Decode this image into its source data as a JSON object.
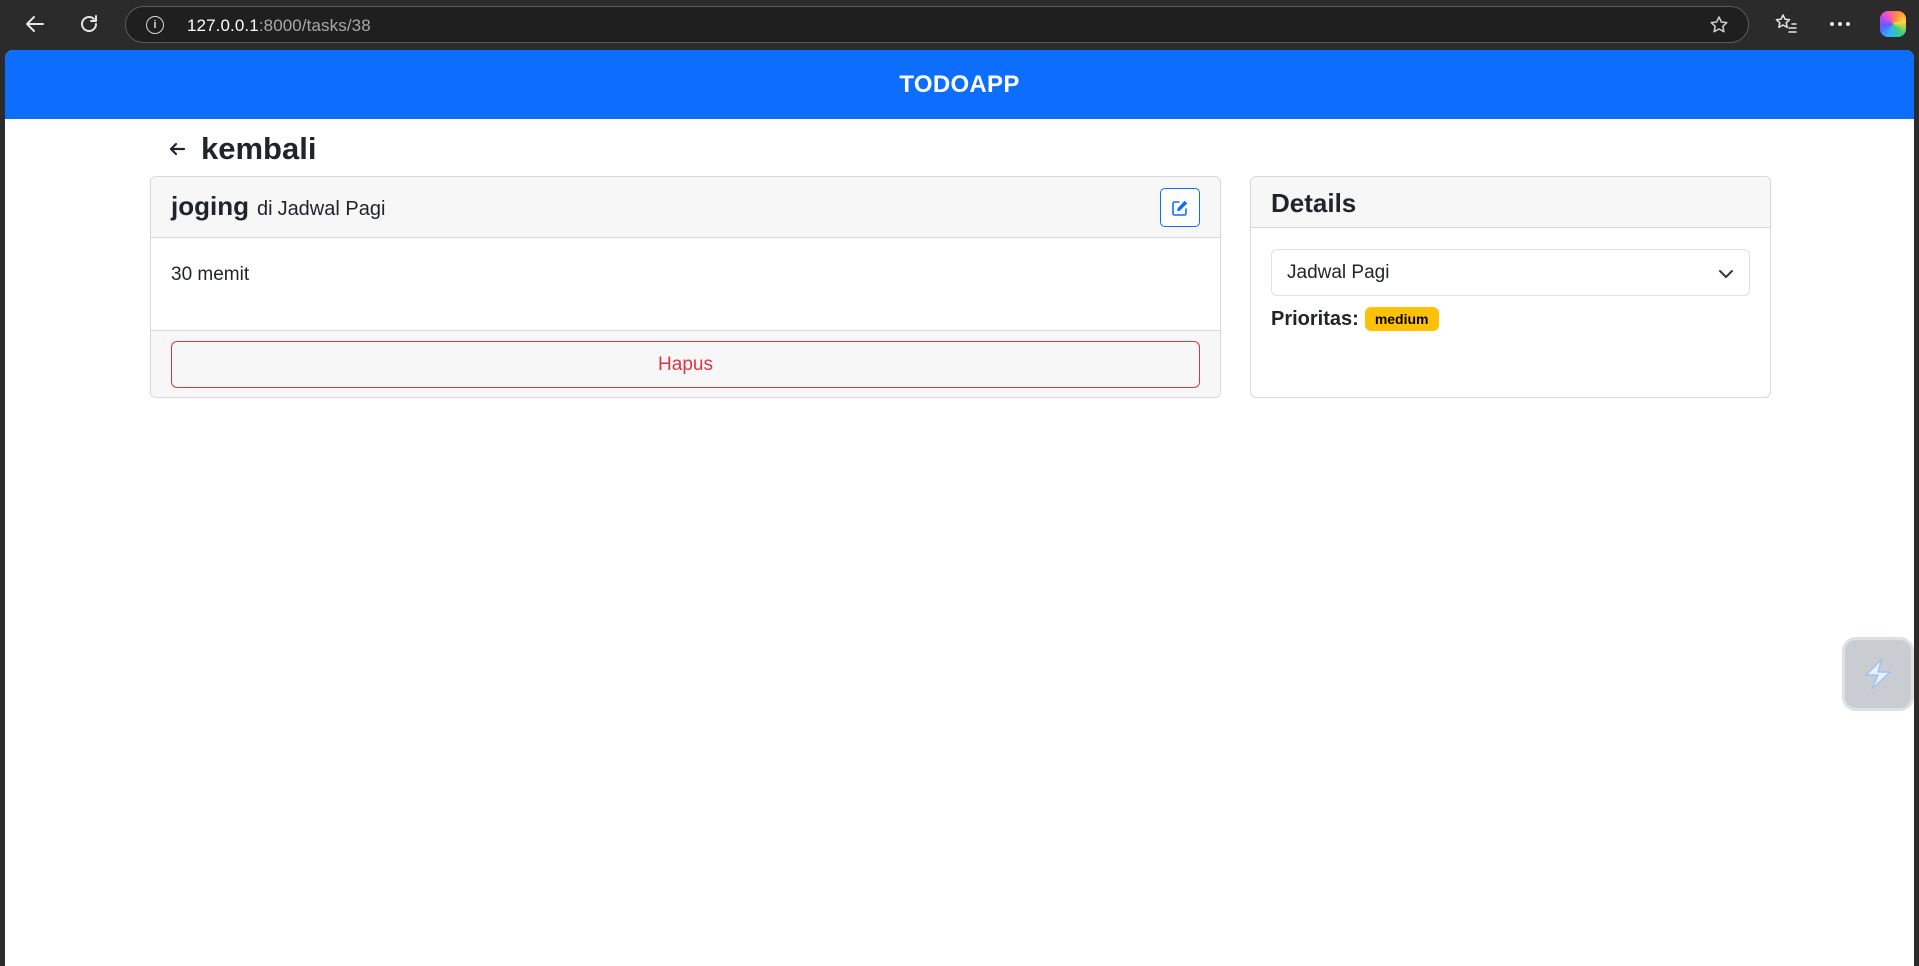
{
  "browser": {
    "url_host": "127.0.0.1",
    "url_rest": ":8000/tasks/38"
  },
  "app": {
    "brand": "TODOAPP",
    "back_label": "kembali"
  },
  "task": {
    "name": "joging",
    "separator": "di",
    "list_name": "Jadwal Pagi",
    "description": "30 memit",
    "delete_label": "Hapus"
  },
  "details": {
    "title": "Details",
    "selected_list": "Jadwal Pagi",
    "priority_label": "Prioritas:",
    "priority_value": "medium"
  },
  "colors": {
    "primary": "#0d6efd",
    "danger": "#dc3545",
    "warning": "#ffc107"
  }
}
